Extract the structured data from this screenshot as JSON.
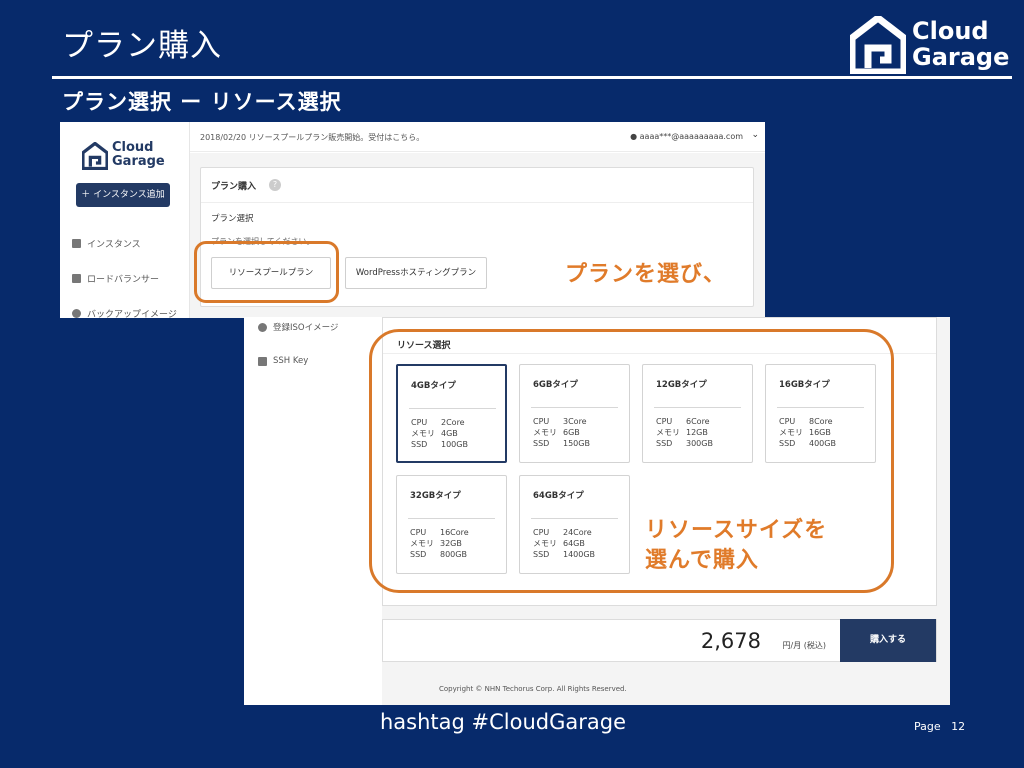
{
  "slide": {
    "title": "プラン購入",
    "subtitle": "プラン選択 ー リソース選択",
    "logo_line1": "Cloud",
    "logo_line2": "Garage",
    "footer_hashtag": "hashtag  #CloudGarage",
    "page_label": "Page",
    "page_number": "12"
  },
  "screen1": {
    "logo_line1": "Cloud",
    "logo_line2": "Garage",
    "add_instance_label": "＋ インスタンス追加",
    "nav": [
      "インスタンス",
      "ロードバランサー",
      "バックアップイメージ"
    ],
    "notice": "2018/02/20  リソースプールプラン販売開始。受付はこちら。",
    "user": "aaaa***@aaaaaaaaa.com",
    "card_title": "プラン購入",
    "plan_select_label": "プラン選択",
    "plan_select_hint": "プランを選択してください。",
    "plans": [
      "リソースプールプラン",
      "WordPressホスティングプラン"
    ]
  },
  "screen2": {
    "nav": [
      "登録ISOイメージ",
      "SSH Key"
    ],
    "card_title": "リソース選択",
    "resources": [
      {
        "title": "4GBタイプ",
        "cpu": "2Core",
        "mem": "4GB",
        "ssd": "100GB"
      },
      {
        "title": "6GBタイプ",
        "cpu": "3Core",
        "mem": "6GB",
        "ssd": "150GB"
      },
      {
        "title": "12GBタイプ",
        "cpu": "6Core",
        "mem": "12GB",
        "ssd": "300GB"
      },
      {
        "title": "16GBタイプ",
        "cpu": "8Core",
        "mem": "16GB",
        "ssd": "400GB"
      },
      {
        "title": "32GBタイプ",
        "cpu": "16Core",
        "mem": "32GB",
        "ssd": "800GB"
      },
      {
        "title": "64GBタイプ",
        "cpu": "24Core",
        "mem": "64GB",
        "ssd": "1400GB"
      }
    ],
    "spec_labels": {
      "cpu": "CPU",
      "mem": "メモリ",
      "ssd": "SSD"
    },
    "price": "2,678",
    "price_unit": "円/月 (税込)",
    "buy_label": "購入する",
    "copyright": "Copyright © NHN Techorus Corp. All Rights Reserved."
  },
  "callouts": {
    "first": "プランを選び、",
    "second_line1": "リソースサイズを",
    "second_line2": "選んで購入"
  },
  "colors": {
    "slide_bg": "#072a6b",
    "accent_orange": "#e07b2a",
    "brand_navy": "#233a64"
  }
}
